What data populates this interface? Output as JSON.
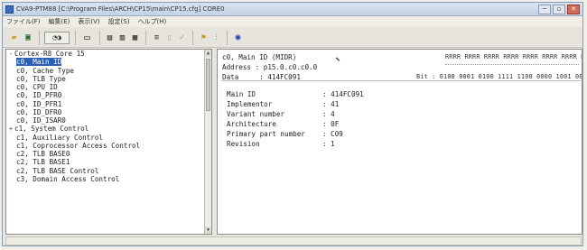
{
  "window": {
    "title": "CVA9-PTM88 [C:\\Program Files\\ARCH\\CP15\\main\\CP15.cfg] CORE0",
    "controls": {
      "minimize": "─",
      "restore": "▫",
      "close": "✕"
    }
  },
  "menu": [
    "ファイル(F)",
    "編集(E)",
    "表示(V)",
    "設定(S)",
    "ヘルプ(H)"
  ],
  "toolbar": {
    "icons": [
      "open-folder-icon",
      "save-icon",
      "connect-icon",
      "find-icon",
      "window-icon",
      "cascade-icon",
      "tile-icon",
      "grid-icon",
      "align-icon",
      "dim-icon",
      "check-icon",
      "info-icon",
      "refresh-icon"
    ]
  },
  "tree": {
    "items": [
      {
        "icon": "-",
        "label": "Cortex-R8 Core 15",
        "level": 0
      },
      {
        "icon": "",
        "label": "c0, Main ID",
        "level": 1,
        "selected": true
      },
      {
        "icon": "",
        "label": "c0, Cache Type",
        "level": 1
      },
      {
        "icon": "",
        "label": "c0, TLB Type",
        "level": 1
      },
      {
        "icon": "",
        "label": "c0, CPU ID",
        "level": 1
      },
      {
        "icon": "",
        "label": "c0, ID_PFR0",
        "level": 1
      },
      {
        "icon": "",
        "label": "c0, ID_PFR1",
        "level": 1
      },
      {
        "icon": "",
        "label": "c0, ID_DFR0",
        "level": 1
      },
      {
        "icon": "",
        "label": "c0, ID_ISAR0",
        "level": 1
      },
      {
        "icon": "+",
        "label": "c1, System Control",
        "level": 0
      },
      {
        "icon": "",
        "label": "c1, Auxiliary Control",
        "level": 1
      },
      {
        "icon": "",
        "label": "c1, Coprocessor Access Control",
        "level": 1
      },
      {
        "icon": "",
        "label": "c2, TLB BASE0",
        "level": 1
      },
      {
        "icon": "",
        "label": "c2, TLB BASE1",
        "level": 1
      },
      {
        "icon": "",
        "label": "c2, TLB BASE Control",
        "level": 1
      },
      {
        "icon": "",
        "label": "c3, Domain Access Control",
        "level": 1
      }
    ]
  },
  "detail": {
    "header": "c0, Main ID (MIDR)",
    "address_label": "Address",
    "address_value": "p15.0.c0.c0.0",
    "data_label": "Data",
    "data_value": "414FC091",
    "bit_labels": "RRRR RRRR RRRR RRRR RRRR RRRR RRRR RRRR",
    "bit_prefix": "Bit :",
    "bit_values": "0100 0001 0100 1111 1100 0000 1001 0001",
    "fields": [
      {
        "name": "Main ID",
        "value": ": 414FC091"
      },
      {
        "name": "Implementor",
        "value": ": 41"
      },
      {
        "name": "Variant number",
        "value": ": 4"
      },
      {
        "name": "Architecture",
        "value": ": 0F"
      },
      {
        "name": "Primary part number",
        "value": ": C09"
      },
      {
        "name": "Revision",
        "value": ": 1"
      }
    ]
  },
  "colors": {
    "selection": "#2c5fb5",
    "title_bar": "#c3d2e6"
  }
}
